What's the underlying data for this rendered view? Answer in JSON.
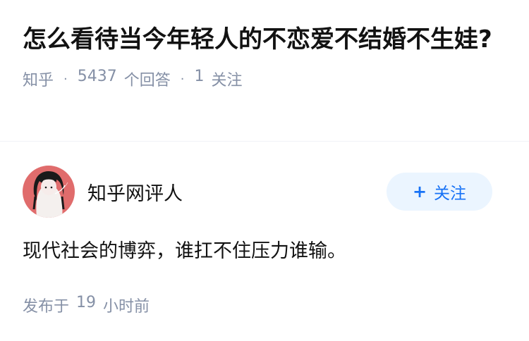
{
  "question": {
    "title": "怎么看待当今年轻人的不恋爱不结婚不生娃?",
    "source": "知乎",
    "answer_count": "5437",
    "answer_label": "个回答",
    "follower_count": "1",
    "follower_label": "关注",
    "separator": "·"
  },
  "answer": {
    "author_name": "知乎网评人",
    "follow_button": {
      "icon": "plus-icon",
      "label": "关注"
    },
    "content": "现代社会的博弈，谁扛不住压力谁输。",
    "published_prefix": "发布于",
    "published_value": "19",
    "published_suffix": "小时前"
  },
  "colors": {
    "title": "#121212",
    "meta": "#8590a6",
    "follow_bg": "#ebf5ff",
    "follow_text": "#1772f6",
    "avatar_bg": "#e06c6c"
  }
}
